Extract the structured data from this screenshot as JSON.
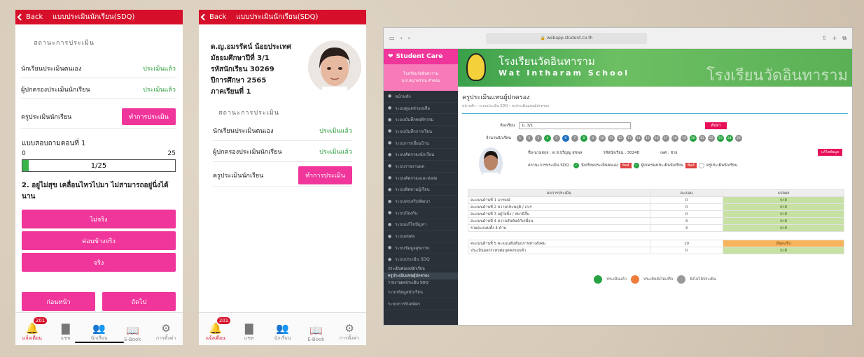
{
  "phone1": {
    "title": "แบบประเมินนักเรียน(SDQ)",
    "back": "Back",
    "section": "สถานะการประเมิน",
    "rows": [
      {
        "label": "นักเรียนประเมินตนเอง",
        "status": "ประเมินแล้ว"
      },
      {
        "label": "ผู้ปกครองประเมินนักเรียน",
        "status": "ประเมินแล้ว"
      }
    ],
    "teacher_label": "ครูประเมินนักเรียน",
    "teacher_button": "ทำการประเมิน",
    "quiz_title": "แบบสอบถามตอนที่ 1",
    "range_min": "0",
    "range_max": "25",
    "progress_text": "1/25",
    "progress": 0.04,
    "question": "2. อยู่ไม่สุข เคลื่อนไหวไปมา ไม่สามารถอยู่นิ่งได้นาน",
    "options": [
      "ไม่จริง",
      "ค่อนข้างจริง",
      "จริง"
    ],
    "prev": "ก่อนหน้า",
    "next": "ถัดไป"
  },
  "phone2": {
    "title": "แบบประเมินนักเรียน(SDQ)",
    "back": "Back",
    "student": [
      "ด.ญ.อมรรัตน์ น้อยประเทศ",
      "มัธยมศึกษาปีที่ 3/1",
      "รหัสนักเรียน 30269",
      "ปีการศึกษา 2565",
      "ภาคเรียนที่ 1"
    ],
    "section": "สถานะการประเมิน",
    "rows": [
      {
        "label": "นักเรียนประเมินตนเอง",
        "status": "ประเมินแล้ว"
      },
      {
        "label": "ผู้ปกครองประเมินนักเรียน",
        "status": "ประเมินแล้ว"
      }
    ],
    "teacher_label": "ครูประเมินนักเรียน",
    "teacher_button": "ทำการประเมิน"
  },
  "tabbar": {
    "badge": "201",
    "tabs": [
      {
        "label": "แจ้งเตือน",
        "icon": "bell-icon"
      },
      {
        "label": "แชท",
        "icon": "chat-icon"
      },
      {
        "label": "นักเรียน",
        "icon": "students-icon"
      },
      {
        "label": "E-Book",
        "icon": "book-icon"
      },
      {
        "label": "การตั้งค่า",
        "icon": "gear-icon"
      }
    ]
  },
  "web": {
    "url": "webapp.student.co.th",
    "brand": "Student Care",
    "school_small_1": "โรงเรียนวัดอินทาราม",
    "school_small_2": "น.ส.สญาพรรณ คำหอม",
    "school_th": "โรงเรียนวัดอินทาราม",
    "school_en": "Wat Intharam School",
    "school_big": "โรงเรียนวัดอินทาราม",
    "page_title": "ครูประเมินแทนผู้ปกครอง",
    "breadcrumb": "หน้าหลัก › ระบบประเมิน SDQ › ครูประเมินแทนผู้ปกครอง",
    "room_label": "ห้องเรียน",
    "room_value": "ม. 3/1",
    "search_button": "ค้นหา",
    "count_label": "จำนวนนักเรียน",
    "numbers": [
      "1",
      "2",
      "3",
      "4",
      "5",
      "6",
      "7",
      "8",
      "9",
      "10",
      "11",
      "12",
      "13",
      "14",
      "15",
      "16",
      "17",
      "18",
      "19",
      "20",
      "21",
      "22",
      "23",
      "24",
      "25"
    ],
    "number_states": [
      "n",
      "n",
      "n",
      "g",
      "n",
      "b",
      "n",
      "g",
      "n",
      "n",
      "n",
      "n",
      "n",
      "n",
      "n",
      "n",
      "n",
      "n",
      "n",
      "g",
      "n",
      "n",
      "g",
      "g",
      "n"
    ],
    "student_name": "ชื่อ-นามสกุล : ด.ช.ปริญญ สุขพล",
    "student_id": "รหัสนักเรียน : 30248",
    "student_sex": "เพศ : ชาย",
    "detail_button": "แก้ไขข้อมูล",
    "status_line": "สถานะการประเมิน SDQ :",
    "s1": "นักเรียนประเมินตนเอง",
    "s2": "ผู้ปกครองประเมินนักเรียน",
    "s3": "ครูประเมินนักเรียน",
    "print": "พิมพ์",
    "table_headers": [
      "ผลการประเมิน",
      "คะแนน",
      "แปลผล"
    ],
    "table_rows": [
      [
        "คะแนนด้านที่ 1 อารมณ์",
        "0",
        "ปกติ"
      ],
      [
        "คะแนนด้านที่ 2 ความประพฤติ / เกเร",
        "0",
        "ปกติ"
      ],
      [
        "คะแนนด้านที่ 3 อยู่ไม่นิ่ง / สมาธิสั้น",
        "0",
        "ปกติ"
      ],
      [
        "คะแนนด้านที่ 4 ความสัมพันธ์กับเพื่อน",
        "4",
        "ปกติ"
      ],
      [
        "รวมคะแนนทั้ง 4 ด้าน",
        "4",
        "ปกติ"
      ]
    ],
    "table_rows2": [
      [
        "คะแนนด้านที่ 5 คะแนนสัมพันธภาพทางสังคม",
        "10",
        "มีจุดแข็ง"
      ],
      [
        "ประเมินผลกระทบต่อบุคคลรอบตัว",
        "0",
        "ปกติ"
      ]
    ],
    "legend": [
      "ประเมินแล้ว",
      "ประเมินยังไม่เสร็จ",
      "ยังไม่ได้ประเมิน"
    ],
    "menu": [
      "หน้าหลัก",
      "ระบบดูแลช่วยเหลือ",
      "ระบบบันทึกพฤติกรรม",
      "ระบบบันทึกการเรียน",
      "ระบบการเยี่ยมบ้าน",
      "ระบบคัดกรองนักเรียน",
      "ระบบรายงานผล",
      "ระบบคัดกรองและส่งต่อ",
      "ระบบติดตามผู้เรียน",
      "ระบบส่งเสริมพัฒนา",
      "ระบบป้องกัน",
      "ระบบแก้ไขปัญหา",
      "ระบบส่งต่อ",
      "ระบบข้อมูลสุขภาพ",
      "ระบบประเมิน SDQ"
    ],
    "submenu": [
      "ประเมินตนเองนักเรียน",
      "ครูประเมินแทนผู้ปกครอง",
      "รายงานผลประเมิน SDQ"
    ],
    "menu_after": [
      "ระบบข้อมูลนักเรียน",
      "ระบบการรับสมัคร"
    ]
  }
}
